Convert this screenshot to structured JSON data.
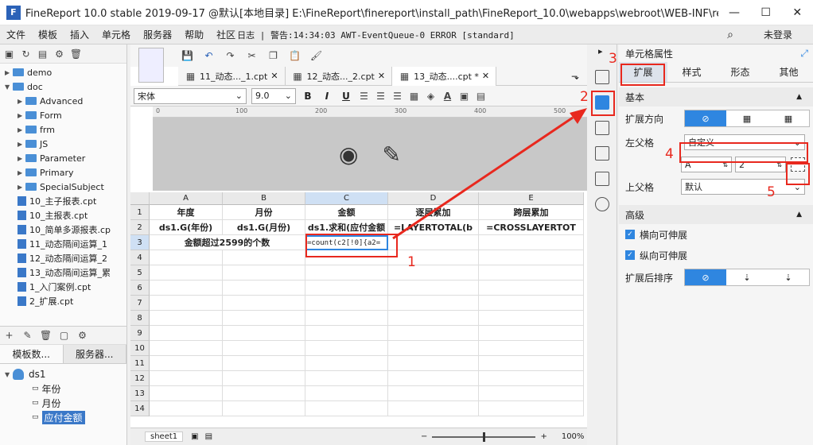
{
  "titlebar": {
    "title": "FineReport 10.0 stable 2019-09-17 @默认[本地目录]    E:\\FineReport\\finereport\\install_path\\FineReport_10.0\\webapps\\webroot\\WEB-INF\\reportlet...",
    "minimize": "—",
    "maximize": "☐",
    "close": "✕"
  },
  "menu": {
    "items": [
      "文件",
      "模板",
      "插入",
      "单元格",
      "服务器",
      "帮助",
      "社区"
    ],
    "log": "日志 | 警告:14:34:03 AWT-EventQueue-0 ERROR [standard]",
    "login": "未登录"
  },
  "tree": {
    "items": [
      {
        "label": "demo",
        "kind": "folder",
        "indent": 0
      },
      {
        "label": "doc",
        "kind": "folder",
        "indent": 0,
        "open": true
      },
      {
        "label": "Advanced",
        "kind": "folder",
        "indent": 1
      },
      {
        "label": "Form",
        "kind": "folder",
        "indent": 1
      },
      {
        "label": "frm",
        "kind": "folder",
        "indent": 1
      },
      {
        "label": "JS",
        "kind": "folder",
        "indent": 1
      },
      {
        "label": "Parameter",
        "kind": "folder",
        "indent": 1
      },
      {
        "label": "Primary",
        "kind": "folder",
        "indent": 1
      },
      {
        "label": "SpecialSubject",
        "kind": "folder",
        "indent": 1
      },
      {
        "label": "10_主子报表.cpt",
        "kind": "file",
        "indent": 1
      },
      {
        "label": "10_主报表.cpt",
        "kind": "file",
        "indent": 1
      },
      {
        "label": "10_简单多源报表.cp",
        "kind": "file",
        "indent": 1
      },
      {
        "label": "11_动态隔间运算_1",
        "kind": "file",
        "indent": 1
      },
      {
        "label": "12_动态隔间运算_2",
        "kind": "file",
        "indent": 1
      },
      {
        "label": "13_动态隔间运算_累",
        "kind": "file",
        "indent": 1
      },
      {
        "label": "1_入门案例.cpt",
        "kind": "file",
        "indent": 1
      },
      {
        "label": "2_扩展.cpt",
        "kind": "file",
        "indent": 1
      }
    ]
  },
  "dstabs": {
    "template": "模板数...",
    "server": "服务器..."
  },
  "dataset": {
    "name": "ds1",
    "fields": [
      "年份",
      "月份",
      "应付金额"
    ]
  },
  "tabs": [
    "11_动态..._1.cpt",
    "12_动态..._2.cpt",
    "13_动态....cpt *"
  ],
  "format": {
    "font": "宋体",
    "size": "9.0",
    "bold": "B",
    "italic": "I",
    "underline": "U"
  },
  "ruler": [
    "0",
    "100",
    "200",
    "300",
    "400",
    "500"
  ],
  "columns": [
    "A",
    "B",
    "C",
    "D",
    "E"
  ],
  "rows": [
    "1",
    "2",
    "3",
    "4",
    "5",
    "6",
    "7",
    "8",
    "9",
    "10",
    "11",
    "12",
    "13",
    "14"
  ],
  "cells": {
    "a1": "年度",
    "b1": "月份",
    "c1": "金额",
    "d1": "逐层累加",
    "e1": "跨层累加",
    "a2": "ds1.G(年份)",
    "b2": "ds1.G(月份)",
    "c2": "ds1.求和(应付金额",
    "d2": "=LAYERTOTAL(b",
    "e2": "=CROSSLAYERTOT",
    "a3": "金额超过2599的个数",
    "c3": "=count(c2[!0]{a2="
  },
  "sheet": {
    "name": "sheet1",
    "zoom": "100%"
  },
  "panel": {
    "title": "单元格属性",
    "tabs": [
      "扩展",
      "样式",
      "形态",
      "其他"
    ],
    "basic": "基本",
    "direction": "扩展方向",
    "leftParent": "左父格",
    "leftValue": "自定义",
    "colValue": "A",
    "rowValue": "2",
    "upParent": "上父格",
    "upValue": "默认",
    "advanced": "高级",
    "hExpand": "横向可伸展",
    "vExpand": "纵向可伸展",
    "sortAfter": "扩展后排序"
  },
  "annotations": [
    "1",
    "2",
    "3",
    "4",
    "5"
  ]
}
